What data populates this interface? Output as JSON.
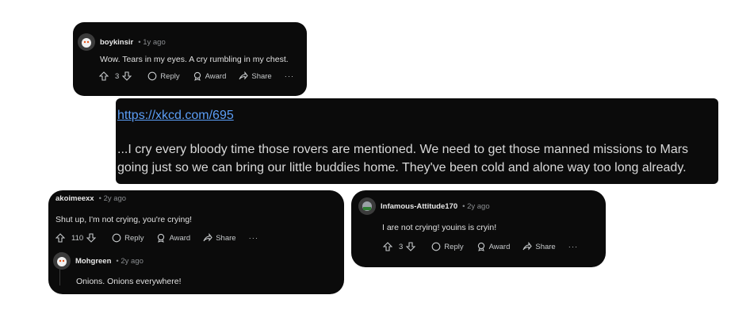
{
  "comments": [
    {
      "user": "boykinsir",
      "time": "1y ago",
      "text": "Wow. Tears in my eyes. A cry rumbling in my chest.",
      "votes": "3",
      "reply": "Reply",
      "award": "Award",
      "share": "Share",
      "more": "···"
    },
    {
      "user": "akoimeexx",
      "time": "2y ago",
      "text": "Shut up, I'm not crying, you're crying!",
      "votes": "110",
      "reply": "Reply",
      "award": "Award",
      "share": "Share",
      "more": "···"
    },
    {
      "user": "Mohgreen",
      "time": "2y ago",
      "text": "Onions. Onions everywhere!"
    },
    {
      "user": "Infamous-Attitude170",
      "time": "2y ago",
      "text": "I are not crying! youins is cryin!",
      "votes": "3",
      "reply": "Reply",
      "award": "Award",
      "share": "Share",
      "more": "···"
    }
  ],
  "xkcd": {
    "link": "https://xkcd.com/695",
    "text": "...I cry every bloody time those rovers are mentioned. We need to get those manned missions to Mars going just so we can bring our little buddies home. They've been cold and alone way too long already."
  }
}
